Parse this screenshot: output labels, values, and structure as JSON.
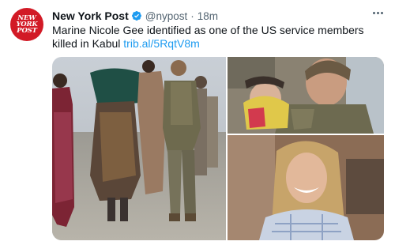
{
  "tweet": {
    "author_name": "New York Post",
    "handle": "@nypost",
    "separator": "·",
    "time": "18m",
    "avatar_logo_lines": [
      "NEW",
      "YORK",
      "POST"
    ],
    "text": "Marine Nicole Gee identified as one of the US service members killed in Kabul",
    "link": "trib.al/5RqtV8m"
  },
  "colors": {
    "link": "#1d9bf0",
    "verified": "#1d9bf0",
    "brand": "#d21a26",
    "muted": "#536471"
  },
  "icons": {
    "verified": "verified-badge-icon",
    "more": "more-options-icon"
  },
  "media": {
    "photo_count": 3
  }
}
